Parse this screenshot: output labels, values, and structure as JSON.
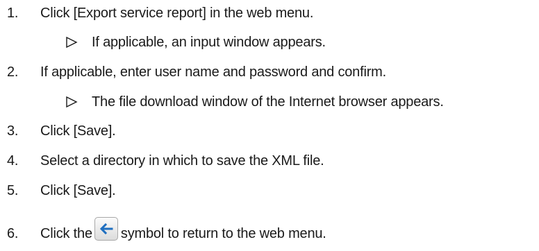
{
  "steps": [
    {
      "number": "1.",
      "text": "Click [Export service report] in the web menu."
    },
    {
      "result": "If applicable, an input window appears."
    },
    {
      "number": "2.",
      "text": "If applicable, enter user name and password and confirm."
    },
    {
      "result": "The file download window of the Internet browser appears."
    },
    {
      "number": "3.",
      "text": "Click [Save]."
    },
    {
      "number": "4.",
      "text": "Select a directory in which to save the XML file."
    },
    {
      "number": "5.",
      "text": "Click [Save]."
    },
    {
      "number": "6.",
      "text_before": "Click the",
      "icon": "back-arrow-icon",
      "text_after": "symbol to return to the web menu."
    }
  ],
  "colors": {
    "text": "#1a1a1a",
    "icon_arrow": "#1f6fc0"
  }
}
